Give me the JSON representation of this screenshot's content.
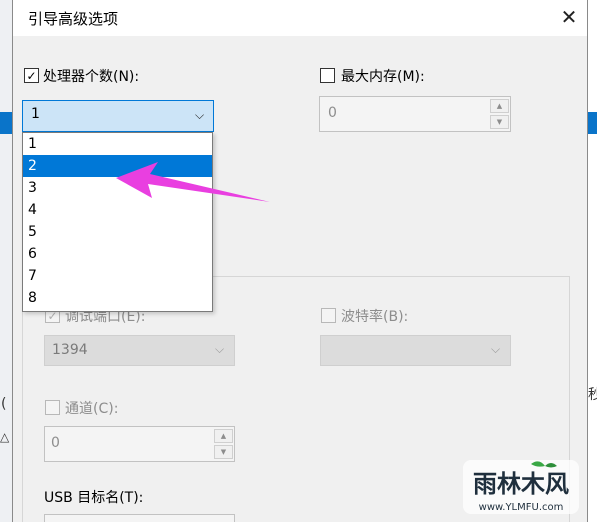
{
  "dialog": {
    "title": "引导高级选项",
    "close_glyph": "✕"
  },
  "processor": {
    "label": "处理器个数(N):",
    "checked": true,
    "selected_value": "1",
    "options": [
      "1",
      "2",
      "3",
      "4",
      "5",
      "6",
      "7",
      "8"
    ],
    "highlighted_option": "2"
  },
  "max_memory": {
    "label": "最大内存(M):",
    "checked": false,
    "value": "0"
  },
  "debug": {
    "port_label": "调试端口(E):",
    "port_value": "1394",
    "baud_label": "波特率(B):",
    "channel_label": "通道(C):",
    "channel_value": "0",
    "usb_label": "USB 目标名(T):"
  },
  "background": {
    "glyph_right": "秒",
    "glyph_left_1": "(",
    "glyph_left_2": "△"
  },
  "watermark": {
    "brand": "雨林木风",
    "url": "www.YLMFU.com"
  },
  "colors": {
    "accent": "#0078d7",
    "annotation_arrow": "#e93fe0"
  }
}
